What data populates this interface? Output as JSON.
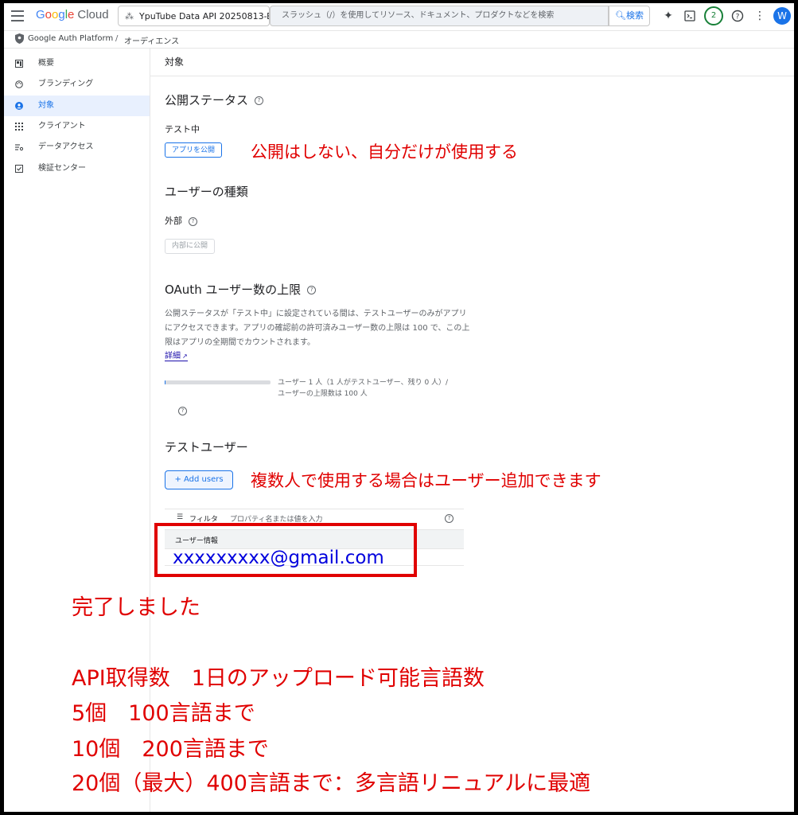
{
  "topbar": {
    "logo_google": [
      "G",
      "o",
      "o",
      "g",
      "l",
      "e"
    ],
    "logo_cloud": "Cloud",
    "project": "YpuTube Data API 20250813-B",
    "search_placeholder": "スラッシュ（/）を使用してリソース、ドキュメント、プロダクトなどを検索",
    "search_button": "検索",
    "badge_count": "2",
    "avatar_initial": "W"
  },
  "breadcrumb": {
    "platform": "Google Auth Platform",
    "separator": "/",
    "current": "オーディエンス"
  },
  "sidebar": {
    "items": [
      {
        "label": "概要",
        "icon": "dashboard-icon"
      },
      {
        "label": "ブランディング",
        "icon": "palette-icon"
      },
      {
        "label": "対象",
        "icon": "person-icon"
      },
      {
        "label": "クライアント",
        "icon": "grid-icon"
      },
      {
        "label": "データアクセス",
        "icon": "settings-list-icon"
      },
      {
        "label": "検証センター",
        "icon": "checkbox-icon"
      }
    ]
  },
  "main": {
    "page_title": "対象",
    "publish_status": {
      "heading": "公開ステータス",
      "status": "テスト中",
      "publish_button": "アプリを公開"
    },
    "user_type": {
      "heading": "ユーザーの種類",
      "type": "外部",
      "make_internal_button": "内部に公開"
    },
    "oauth_limit": {
      "heading": "OAuth ユーザー数の上限",
      "description": "公開ステータスが「テスト中」に設定されている間は、テストユーザーのみがアプリにアクセスできます。アプリの確認前の許可済みユーザー数の上限は 100 で、この上限はアプリの全期間でカウントされます。",
      "more_link": "詳細",
      "progress_fraction": 0.01,
      "progress_text": "ユーザー 1 人（1 人がテストユーザー、残り 0 人）/ ユーザーの上限数は 100 人"
    },
    "test_users": {
      "heading": "テストユーザー",
      "add_button": "+ Add users",
      "filter_label": "フィルタ",
      "filter_placeholder": "プロパティ名または値を入力",
      "column_header": "ユーザー情報"
    }
  },
  "annotations": {
    "publish_note": "公開はしない、自分だけが使用する",
    "add_users_note": "複数人で使用する場合はユーザー追加できます",
    "email": "xxxxxxxxx@gmail.com",
    "done": "完了しました",
    "api_heading": "API取得数　1日のアップロード可能言語数",
    "line_5": "5個　100言語まで",
    "line_10": "10個　200言語まで",
    "line_20": "20個（最大）400言語まで：多言語リニュアルに最適"
  },
  "colors": {
    "accent": "#1a73e8",
    "annotation_red": "#e00000",
    "email_blue": "#0000dd"
  }
}
